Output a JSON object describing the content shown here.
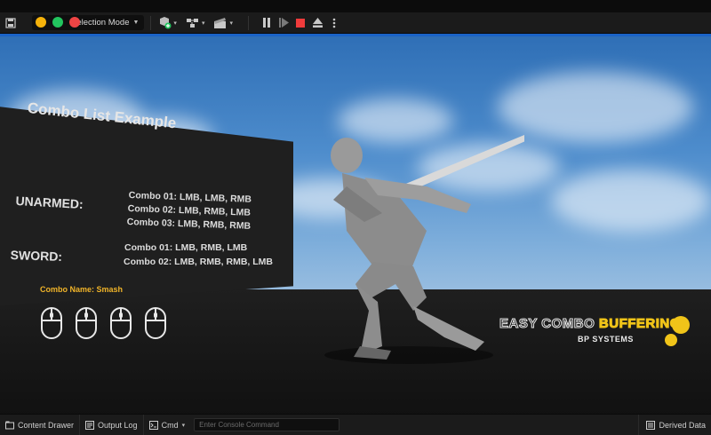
{
  "toolbar": {
    "mode_label": "Selection Mode",
    "traffic_colors": [
      "#f5b20a",
      "#22c55e",
      "#ef4444"
    ],
    "icons": [
      "save-icon",
      "add-actor-icon",
      "blueprint-icon",
      "cinematics-icon",
      "pause-icon",
      "step-icon",
      "stop-icon",
      "eject-icon",
      "more-options-icon"
    ]
  },
  "billboard": {
    "title": "Combo List Example",
    "categories": [
      {
        "name": "UNARMED:",
        "combos": [
          "Combo 01: LMB, LMB, RMB",
          "Combo 02: LMB, RMB, LMB",
          "Combo 03: LMB, RMB, RMB"
        ]
      },
      {
        "name": "SWORD:",
        "combos": [
          "Combo 01: LMB, RMB, LMB",
          "Combo 02: LMB, RMB, RMB, LMB"
        ]
      }
    ]
  },
  "hud": {
    "combo_name": "Combo Name: Smash",
    "mouse_icon_count": 4,
    "accent_color": "#f0b429"
  },
  "logo": {
    "main_white": "EASY COMBO ",
    "main_yellow": "BUFFERING",
    "sub": "BP SYSTEMS"
  },
  "bottombar": {
    "content_drawer": "Content Drawer",
    "output_log": "Output Log",
    "cmd": "Cmd",
    "console_placeholder": "Enter Console Command",
    "derived_data": "Derived Data"
  }
}
